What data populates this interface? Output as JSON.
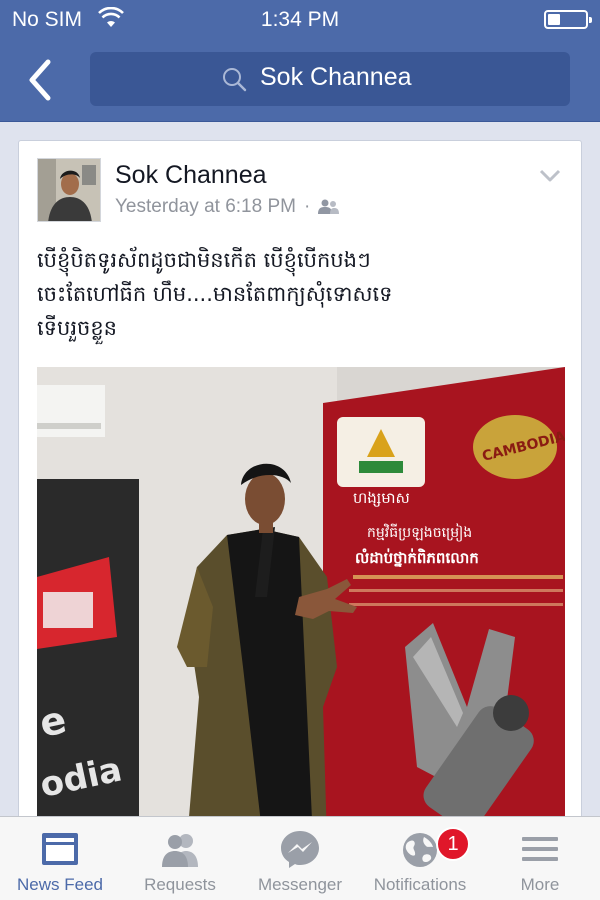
{
  "status_bar": {
    "carrier": "No SIM",
    "time": "1:34 PM"
  },
  "nav": {
    "search_text": "Sok Channea"
  },
  "post": {
    "author": "Sok Channea",
    "timestamp": "Yesterday at 6:18 PM",
    "separator": "·",
    "audience_icon": "friends-icon",
    "text_lines": [
      "បើខ្ញុំបិតទូរស័ពដូចជាមិនកើត បើខ្ញុំបើកបងៗ",
      "ចេះតែហៅធីក ហឹម....មានតែពាក្យសុំទោសទេ",
      "ទើបរួចខ្លួន"
    ],
    "photo_logo_text_1": "ហង្សមាស",
    "photo_logo_text_2": "CAMBODIA",
    "photo_banner_texts": [
      "កម្មវិធីប្រឡងចម្រៀង",
      "លំដាប់ថ្នាក់ពិភពលោក"
    ]
  },
  "tabs": [
    {
      "label": "News Feed",
      "icon": "news-feed-icon",
      "active": true
    },
    {
      "label": "Requests",
      "icon": "requests-icon"
    },
    {
      "label": "Messenger",
      "icon": "messenger-icon"
    },
    {
      "label": "Notifications",
      "icon": "notifications-globe-icon",
      "badge": "1"
    },
    {
      "label": "More",
      "icon": "more-menu-icon"
    }
  ],
  "colors": {
    "header": "#4c6aa9",
    "active_tab": "#4c6aa9",
    "badge": "#e0172a"
  }
}
